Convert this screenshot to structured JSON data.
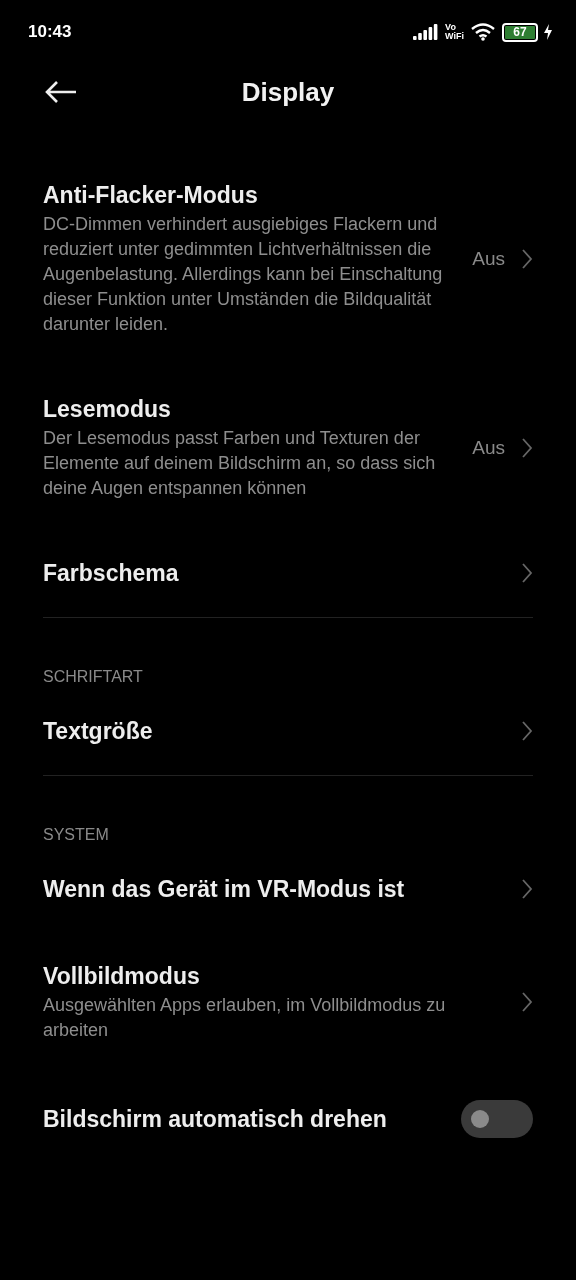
{
  "status_bar": {
    "time": "10:43",
    "vowifi_top": "Vo",
    "vowifi_bottom": "WiFi",
    "battery": "67"
  },
  "header": {
    "title": "Display"
  },
  "sections": [
    {
      "items": [
        {
          "kind": "nav",
          "title": "Anti-Flacker-Modus",
          "description": "DC-Dimmen verhindert ausgiebiges Flackern und reduziert unter gedimmten Lichtverhältnissen die Augenbelastung. Allerdings kann bei Einschaltung dieser Funktion unter Umständen die Bildqualität darunter leiden.",
          "value": "Aus"
        },
        {
          "kind": "nav",
          "title": "Lesemodus",
          "description": "Der Lesemodus passt Farben und Texturen der Elemente auf deinem Bildschirm an, so dass sich deine Augen entspannen können",
          "value": "Aus"
        },
        {
          "kind": "nav",
          "title": "Farbschema"
        }
      ]
    },
    {
      "header": "SCHRIFTART",
      "items": [
        {
          "kind": "nav",
          "title": "Textgröße"
        }
      ]
    },
    {
      "header": "SYSTEM",
      "items": [
        {
          "kind": "nav",
          "title": "Wenn das Gerät im VR-Modus ist"
        },
        {
          "kind": "nav",
          "title": "Vollbildmodus",
          "description": "Ausgewählten Apps erlauben, im Vollbildmodus zu arbeiten"
        },
        {
          "kind": "toggle",
          "title": "Bildschirm automatisch drehen",
          "on": false
        }
      ]
    }
  ]
}
